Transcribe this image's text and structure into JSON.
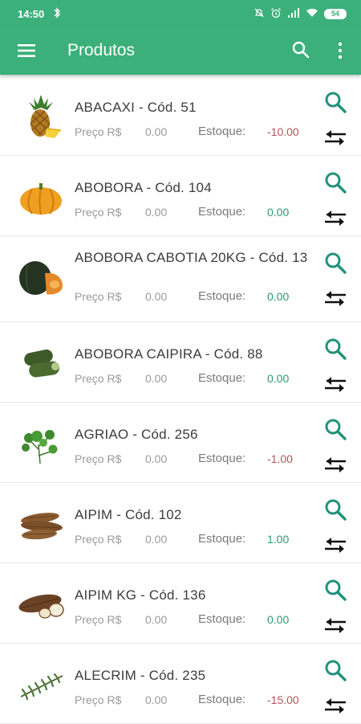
{
  "status_bar": {
    "time": "14:50",
    "battery": "54",
    "icons": [
      "bluetooth-icon",
      "mute-icon",
      "alarm-icon",
      "signal-icon",
      "wifi-icon",
      "battery-icon"
    ]
  },
  "app_bar": {
    "title": "Produtos",
    "icons": [
      "menu-icon",
      "search-icon",
      "more-vert-icon"
    ]
  },
  "colors": {
    "primary": "#3bb07a",
    "action_teal": "#23927a",
    "stock_positive": "#2c9a74",
    "stock_negative": "#b5525c"
  },
  "labels": {
    "price": "Preço R$",
    "stock": "Estoque:"
  },
  "products": [
    {
      "name": "ABACAXI - Cód. 51",
      "price": "0.00",
      "stock": "-10.00",
      "image": "pineapple"
    },
    {
      "name": "ABOBORA - Cód. 104",
      "price": "0.00",
      "stock": "0.00",
      "image": "pumpkin"
    },
    {
      "name": "ABOBORA CABOTIA 20KG - Cód. 13",
      "price": "0.00",
      "stock": "0.00",
      "image": "kabocha"
    },
    {
      "name": "ABOBORA CAIPIRA - Cód. 88",
      "price": "0.00",
      "stock": "0.00",
      "image": "zucchini"
    },
    {
      "name": "AGRIAO - Cód. 256",
      "price": "0.00",
      "stock": "-1.00",
      "image": "watercress"
    },
    {
      "name": "AIPIM - Cód. 102",
      "price": "0.00",
      "stock": "1.00",
      "image": "cassava"
    },
    {
      "name": "AIPIM KG - Cód. 136",
      "price": "0.00",
      "stock": "0.00",
      "image": "cassava-cut"
    },
    {
      "name": "ALECRIM - Cód. 235",
      "price": "0.00",
      "stock": "-15.00",
      "image": "rosemary"
    }
  ]
}
